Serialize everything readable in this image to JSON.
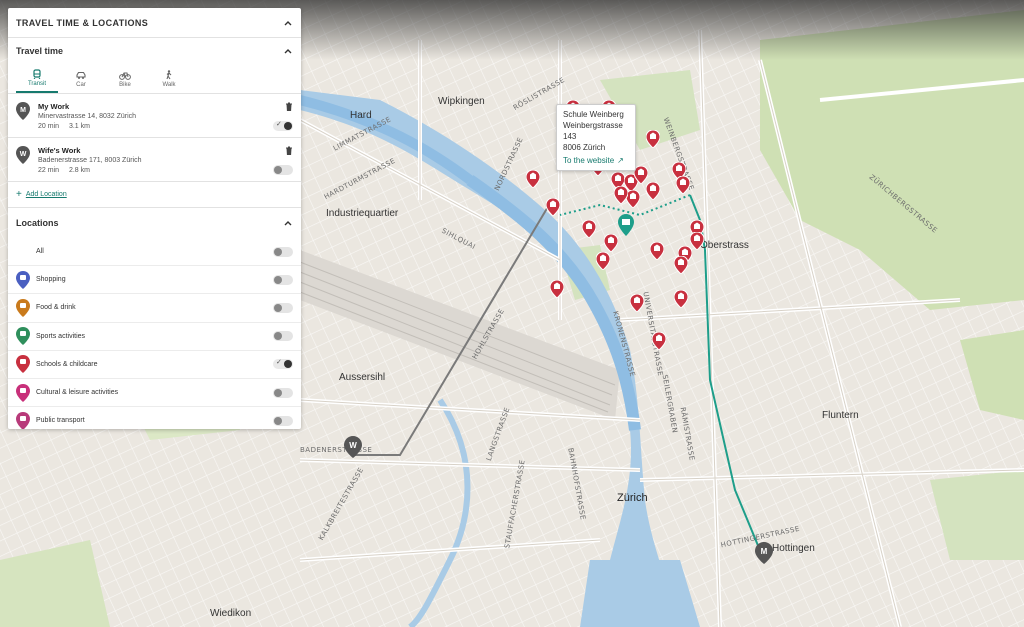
{
  "panel": {
    "title": "TRAVEL TIME & LOCATIONS",
    "travel_time": {
      "title": "Travel time",
      "modes": [
        {
          "label": "Transit",
          "icon": "transit-icon",
          "active": true
        },
        {
          "label": "Car",
          "icon": "car-icon",
          "active": false
        },
        {
          "label": "Bike",
          "icon": "bike-icon",
          "active": false
        },
        {
          "label": "Walk",
          "icon": "walk-icon",
          "active": false
        }
      ],
      "routes": [
        {
          "marker": "M",
          "name": "My Work",
          "address": "Minervastrasse 14, 8032 Zürich",
          "duration": "20 min",
          "distance": "3.1 km",
          "enabled": true
        },
        {
          "marker": "W",
          "name": "Wife's Work",
          "address": "Badenerstrasse 171, 8003 Zürich",
          "duration": "22 min",
          "distance": "2.8 km",
          "enabled": false
        }
      ],
      "add_location": "Add Location"
    },
    "locations": {
      "title": "Locations",
      "items": [
        {
          "label": "All",
          "enabled": false,
          "color": ""
        },
        {
          "label": "Shopping",
          "enabled": false,
          "color": "#4a5fc1"
        },
        {
          "label": "Food & drink",
          "enabled": false,
          "color": "#c97a1c"
        },
        {
          "label": "Sports activities",
          "enabled": false,
          "color": "#2f8f5c"
        },
        {
          "label": "Schools & childcare",
          "enabled": true,
          "color": "#c8303f"
        },
        {
          "label": "Cultural & leisure activities",
          "enabled": false,
          "color": "#c8307a"
        },
        {
          "label": "Public transport",
          "enabled": false,
          "color": "#b83a7a"
        }
      ]
    }
  },
  "map": {
    "tooltip": {
      "name": "Schule Weinberg",
      "street": "Weinbergstrasse 143",
      "city": "8006 Zürich",
      "link": "To the website"
    },
    "places": [
      "Wipkingen",
      "Industriequartier",
      "Aussersihl",
      "Zürich",
      "Oberstrass",
      "Fluntern",
      "Hottingen",
      "Wiedikon",
      "Hard"
    ],
    "streets": [
      "LIMMATSTRASSE",
      "HARDTURMSTRASSE",
      "HOHLSTRASSE",
      "BADENERSTRASSE",
      "LANGSTRASSE",
      "KALKBREITESTRASSE",
      "SEILERGRABEN",
      "UNIVERSITÄTSTRASSE",
      "WEINBERGSTRASSE",
      "ZÜRICHBERGSTRASSE",
      "HOTTINGERSTRASSE",
      "RÄMISTRASSE",
      "BAHNHOFSTRASSE",
      "STAUFFACHERSTRASSE",
      "SIHLQUAI",
      "NORDSTRASSE",
      "RÖSLISTRASSE",
      "KRONENSTRASSE"
    ],
    "route_colors": {
      "transit": "#1e9e8a",
      "wife": "#6b6b6b"
    }
  }
}
